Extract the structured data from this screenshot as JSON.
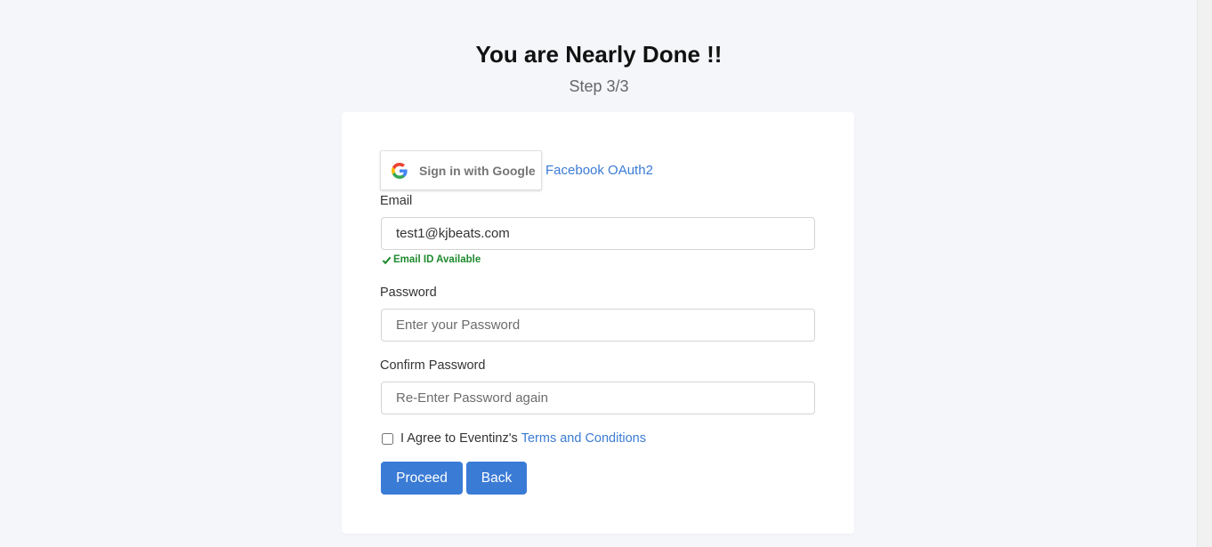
{
  "header": {
    "title": "You are Nearly Done !!",
    "step": "Step 3/3"
  },
  "social": {
    "google_label": "Sign in with Google",
    "facebook_label": "Facebook OAuth2"
  },
  "form": {
    "email_label": "Email",
    "email_value": "test1@kjbeats.com",
    "email_status": "Email ID Available",
    "password_label": "Password",
    "password_placeholder": "Enter your Password",
    "confirm_label": "Confirm Password",
    "confirm_placeholder": "Re-Enter Password again",
    "agree_text": "I Agree to Eventinz's",
    "terms_link": "Terms and Conditions",
    "agree_checked": false
  },
  "actions": {
    "proceed_label": "Proceed",
    "back_label": "Back"
  },
  "colors": {
    "accent": "#3a7bd5",
    "success": "#1e8a2e",
    "background": "#f4f6fa"
  },
  "icons": {
    "google": "google-g-icon",
    "status": "checkmark-icon"
  }
}
